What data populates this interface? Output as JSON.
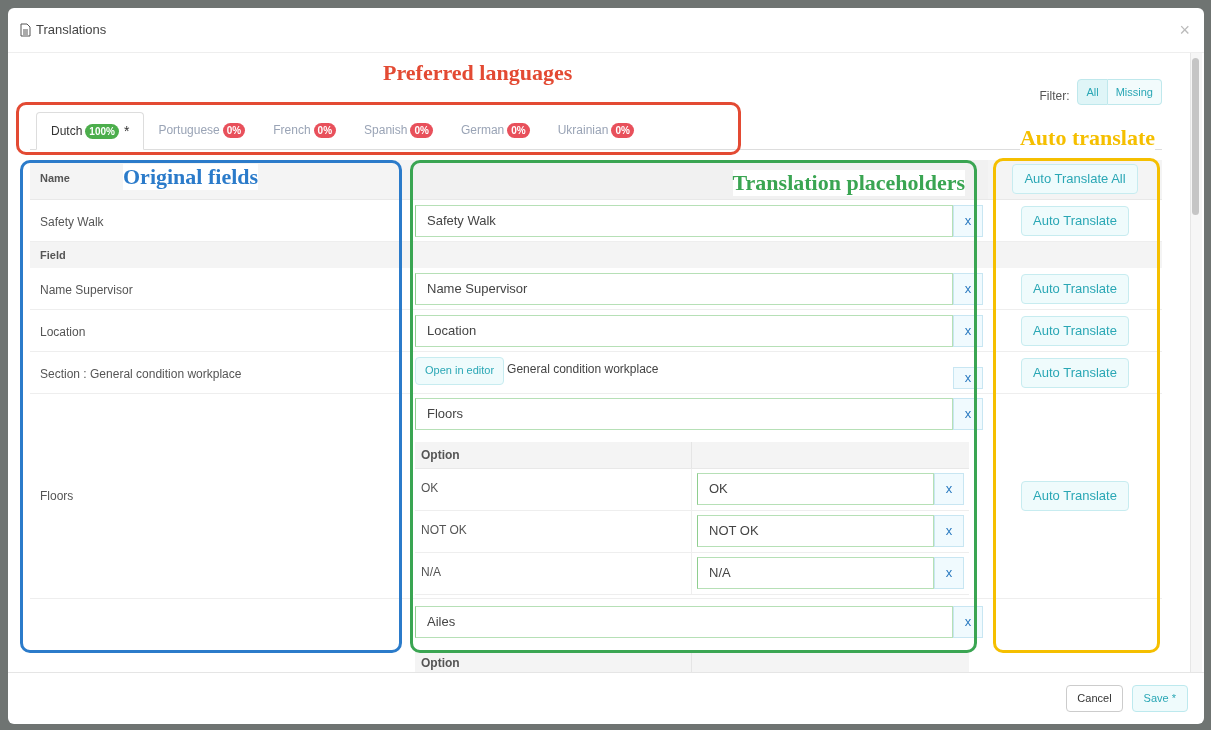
{
  "window": {
    "title": "Translations",
    "close": "×"
  },
  "filter": {
    "label": "Filter:",
    "options": [
      {
        "label": "All",
        "selected": true
      },
      {
        "label": "Missing",
        "selected": false
      }
    ]
  },
  "tabs": [
    {
      "label": "Dutch",
      "badge": "100%",
      "color": "#4cae4c",
      "selected": true,
      "mark": "*"
    },
    {
      "label": "Portuguese",
      "badge": "0%",
      "color": "#e8505b",
      "selected": false
    },
    {
      "label": "French",
      "badge": "0%",
      "color": "#e8505b",
      "selected": false
    },
    {
      "label": "Spanish",
      "badge": "0%",
      "color": "#e8505b",
      "selected": false
    },
    {
      "label": "German",
      "badge": "0%",
      "color": "#e8505b",
      "selected": false
    },
    {
      "label": "Ukrainian",
      "badge": "0%",
      "color": "#e8505b",
      "selected": false
    }
  ],
  "table": {
    "name_header": "Name",
    "auto_translate_all": "Auto Translate All",
    "rows": [
      {
        "kind": "field",
        "original": "Safety Walk",
        "value": "Safety Walk",
        "clear": "x",
        "auto_translate": "Auto Translate"
      },
      {
        "kind": "group",
        "label": "Field"
      },
      {
        "kind": "field",
        "original": "Name Supervisor",
        "value": "Name Supervisor",
        "clear": "x",
        "auto_translate": "Auto Translate"
      },
      {
        "kind": "field",
        "original": "Location",
        "value": "Location",
        "clear": "x",
        "auto_translate": "Auto Translate"
      },
      {
        "kind": "section",
        "original": "Section : General condition workplace",
        "editor_button": "Open in editor",
        "value": "General condition workplace",
        "clear": "x",
        "auto_translate": "Auto Translate"
      },
      {
        "kind": "options",
        "original": "Floors",
        "value": "Floors",
        "clear": "x",
        "auto_translate": "Auto Translate",
        "options_header": "Option",
        "options": [
          {
            "original": "OK",
            "value": "OK",
            "clear": "x"
          },
          {
            "original": "NOT OK",
            "value": "NOT OK",
            "clear": "x"
          },
          {
            "original": "N/A",
            "value": "N/A",
            "clear": "x"
          }
        ]
      },
      {
        "kind": "options",
        "value": "Ailes",
        "clear": "x",
        "options_header": "Option"
      }
    ]
  },
  "annotations": [
    {
      "text": "Preferred languages",
      "color": "#e34a33"
    },
    {
      "text": "Original fields",
      "color": "#2b7bca"
    },
    {
      "text": "Translation placeholders",
      "color": "#3aa552"
    },
    {
      "text": "Auto translate",
      "color": "#f5bf00"
    }
  ],
  "footer": {
    "cancel": "Cancel",
    "save": "Save *"
  }
}
